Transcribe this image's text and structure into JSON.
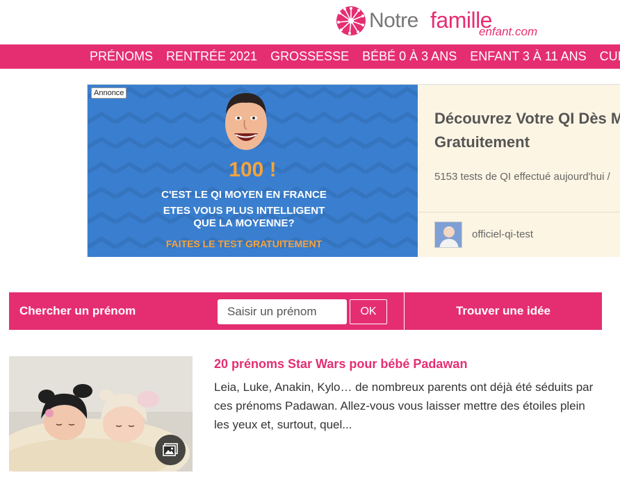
{
  "brand": {
    "logo_notre": "Notre",
    "logo_famille": "famille",
    "logo_enfant": "enfant.com",
    "accent_color": "#e52e72"
  },
  "nav": {
    "items": [
      "PRÉNOMS",
      "RENTRÉE 2021",
      "GROSSESSE",
      "BÉBÉ 0 À 3 ANS",
      "ENFANT 3 À 11 ANS",
      "CUISINE"
    ]
  },
  "ad": {
    "badge": "Annonce",
    "score": "100 !",
    "line1": "C'EST LE QI MOYEN EN FRANCE",
    "line2a": "ETES VOUS PLUS INTELLIGENT",
    "line2b": "QUE LA MOYENNE?",
    "cta": "FAITES LE TEST GRATUITEMENT",
    "title_line1": "Découvrez Votre QI Dès M",
    "title_line2": "Gratuitement",
    "description": "5153 tests de QI effectué aujourd'hui /",
    "source": "officiel-qi-test"
  },
  "search": {
    "label": "Chercher un prénom",
    "placeholder": "Saisir un prénom",
    "ok_label": "OK",
    "idea_label": "Trouver une idée"
  },
  "article": {
    "title": "20 prénoms Star Wars pour bébé Padawan",
    "excerpt": "Leia, Luke, Anakin, Kylo… de nombreux parents ont déjà été séduits par ces prénoms Padawan. Allez-vous vous laisser mettre des étoiles plein les yeux et, surtout, quel..."
  }
}
